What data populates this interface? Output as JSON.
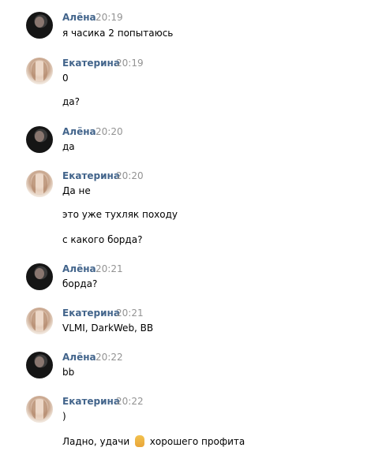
{
  "messages": [
    {
      "author": "Алёна",
      "time": "20:19",
      "lines": [
        "я часика 2 попытаюсь"
      ]
    },
    {
      "author": "Екатерина",
      "time": "20:19",
      "lines": [
        "0",
        "да?"
      ]
    },
    {
      "author": "Алёна",
      "time": "20:20",
      "lines": [
        "да"
      ]
    },
    {
      "author": "Екатерина",
      "time": "20:20",
      "lines": [
        "Да не",
        "это уже тухляк походу",
        "с какого борда?"
      ]
    },
    {
      "author": "Алёна",
      "time": "20:21",
      "lines": [
        "борда?"
      ]
    },
    {
      "author": "Екатерина",
      "time": "20:21",
      "lines": [
        "VLMI, DarkWeb, BB"
      ]
    },
    {
      "author": "Алёна",
      "time": "20:22",
      "lines": [
        "bb"
      ]
    },
    {
      "author": "Екатерина",
      "time": "20:22",
      "lines": [
        ")",
        "Ладно, удачи",
        "хорошего профита"
      ]
    }
  ],
  "colors": {
    "name": "#42648b",
    "time": "#939393",
    "text": "#000000",
    "background": "#ffffff"
  },
  "icons": {
    "emoji": "victory-hand-emoji-icon"
  }
}
